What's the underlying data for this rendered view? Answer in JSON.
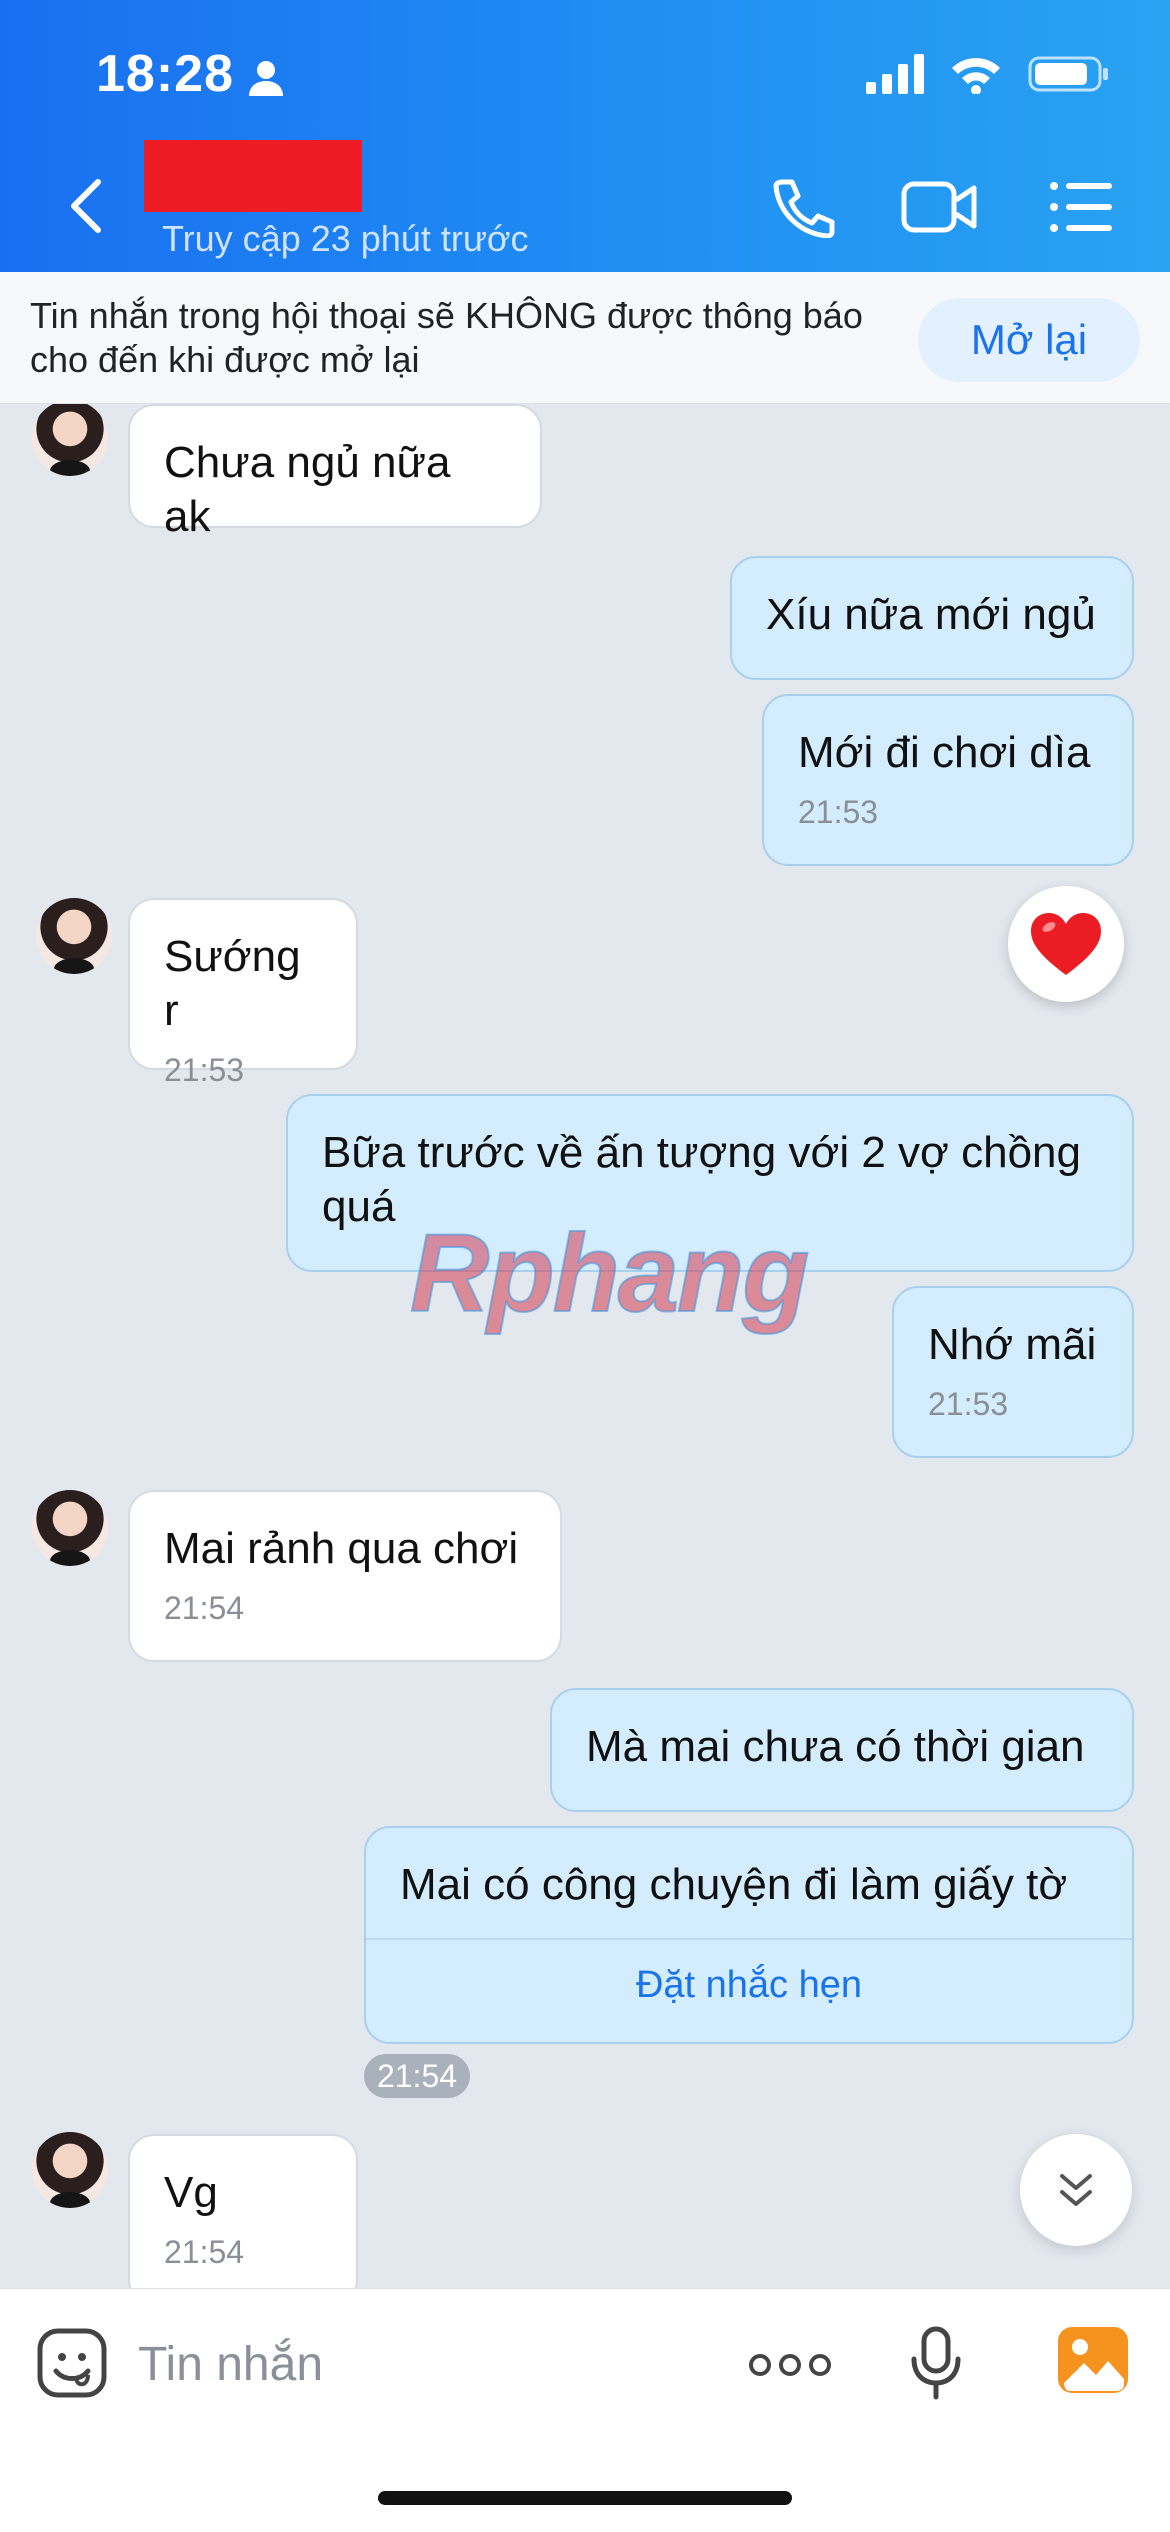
{
  "status_bar": {
    "time": "18:28"
  },
  "header": {
    "last_seen": "Truy cập 23 phút trước",
    "icons": [
      "back-icon",
      "phone-icon",
      "video-icon",
      "menu-list-icon"
    ]
  },
  "notice": {
    "text": "Tin nhắn trong hội thoại sẽ KHÔNG được thông báo cho đến khi được mở lại",
    "button": "Mở lại"
  },
  "messages": [
    {
      "dir": "in",
      "text": "Chưa ngủ nữa ak"
    },
    {
      "dir": "out",
      "text": "Xíu nữa mới ngủ"
    },
    {
      "dir": "out",
      "text": "Mới đi chơi dìa",
      "time": "21:53"
    },
    {
      "dir": "in",
      "text": "Sướng r",
      "time": "21:53"
    },
    {
      "dir": "out",
      "text": "Bữa trước về ấn tượng với 2 vợ chồng quá"
    },
    {
      "dir": "out",
      "text": "Nhớ mãi",
      "time": "21:53"
    },
    {
      "dir": "in",
      "text": "Mai rảnh qua chơi",
      "time": "21:54"
    },
    {
      "dir": "out",
      "text": "Mà mai chưa có thời gian"
    },
    {
      "dir": "out",
      "text": "Mai có công chuyện đi làm giấy tờ",
      "action": "Đặt nhắc hẹn"
    },
    {
      "dir": "in",
      "text": "Vg",
      "time": "21:54"
    }
  ],
  "time_pill": "21:54",
  "watermark": "Rphang",
  "reaction": "heart-icon",
  "composer": {
    "placeholder": "Tin nhắn"
  }
}
